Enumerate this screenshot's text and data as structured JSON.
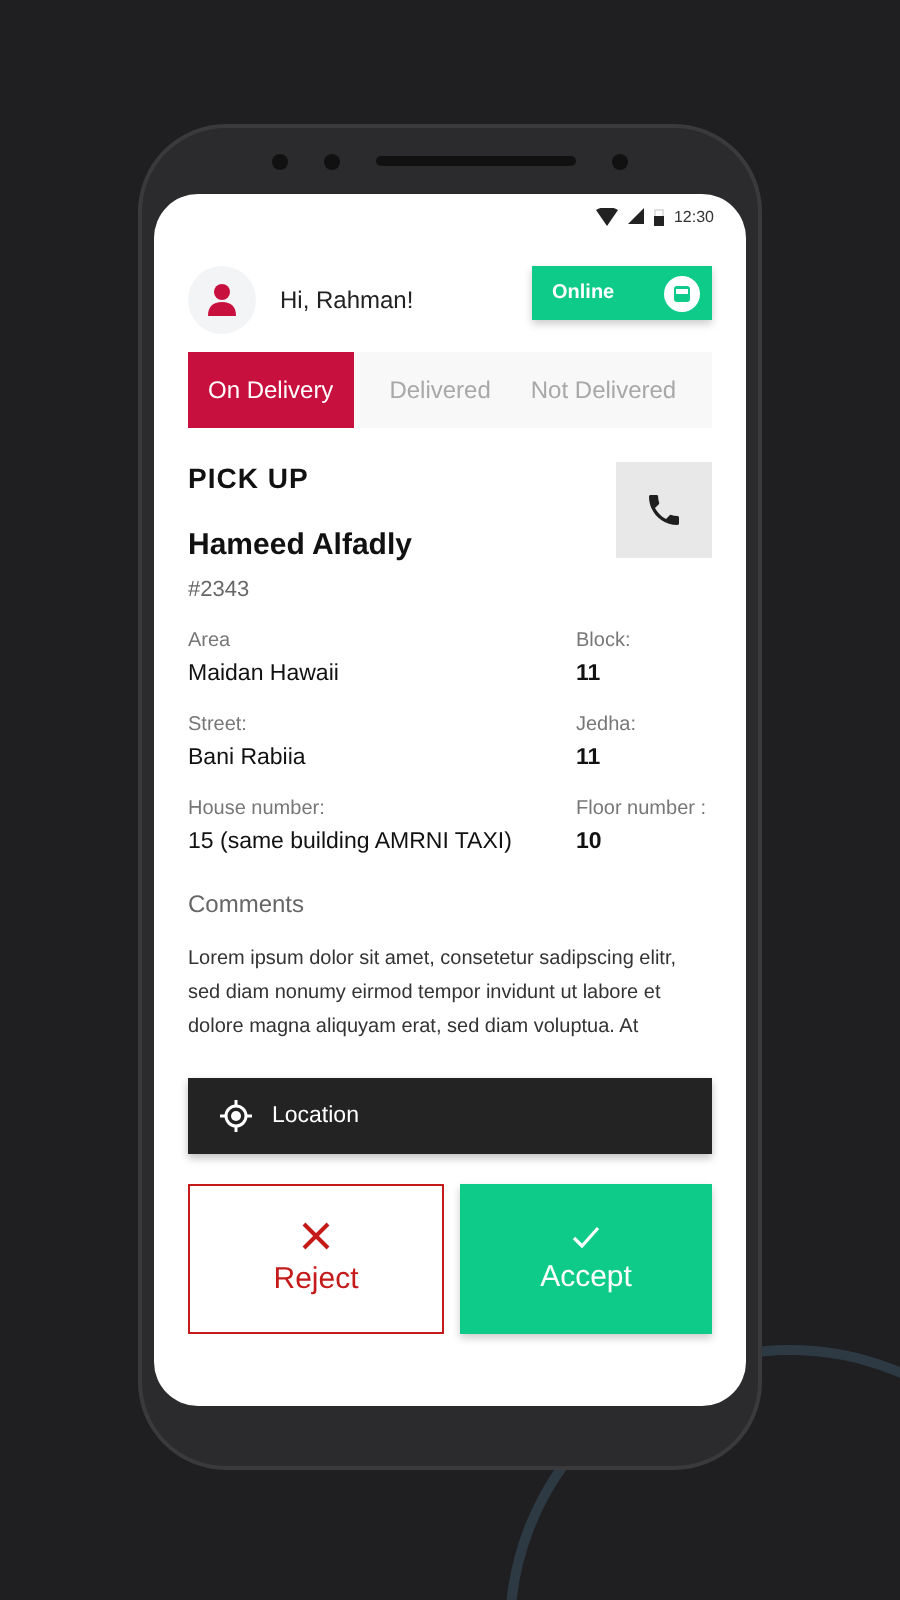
{
  "status_bar": {
    "time": "12:30"
  },
  "header": {
    "greeting": "Hi, Rahman!",
    "status": {
      "label": "Online",
      "on": true
    }
  },
  "tabs": [
    {
      "label": "On Delivery",
      "selected": true
    },
    {
      "label": "Delivered",
      "selected": false
    },
    {
      "label": "Not Delivered",
      "selected": false
    }
  ],
  "order": {
    "section_title": "PICK UP",
    "customer": "Hameed Alfadly",
    "number": "#2343",
    "fields": [
      {
        "label": "Area",
        "value": "Maidan Hawaii",
        "side_label": "Block:",
        "side_value": "11"
      },
      {
        "label": "Street:",
        "value": "Bani Rabiia",
        "side_label": "Jedha:",
        "side_value": "11"
      },
      {
        "label": "House number:",
        "value": "15 (same building AMRNI TAXI)",
        "side_label": "Floor number :",
        "side_value": "10"
      }
    ],
    "comments_label": "Comments",
    "comments": "Lorem ipsum dolor sit amet, consetetur sadipscing elitr, sed diam nonumy eirmod tempor invidunt ut labore et dolore magna aliquyam erat, sed diam voluptua. At"
  },
  "location_button": "Location",
  "actions": [
    {
      "kind": "reject",
      "label": "Reject"
    },
    {
      "kind": "accept",
      "label": "Accept"
    }
  ]
}
